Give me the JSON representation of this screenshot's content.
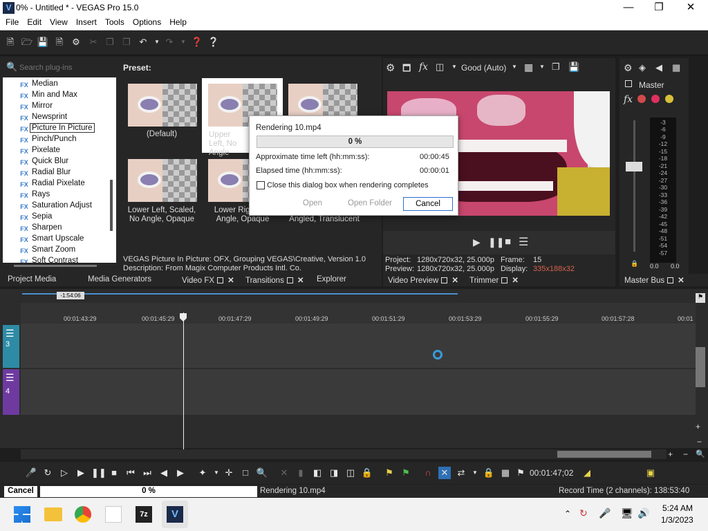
{
  "window": {
    "title": "0% - Untitled * - VEGAS Pro 15.0",
    "app_icon": "V"
  },
  "menu": [
    "File",
    "Edit",
    "View",
    "Insert",
    "Tools",
    "Options",
    "Help"
  ],
  "plugins": {
    "search_placeholder": "Search plug-ins",
    "items": [
      "Median",
      "Min and Max",
      "Mirror",
      "Newsprint",
      "Picture In Picture",
      "Pinch/Punch",
      "Pixelate",
      "Quick Blur",
      "Radial Blur",
      "Radial Pixelate",
      "Rays",
      "Saturation Adjust",
      "Sepia",
      "Sharpen",
      "Smart Upscale",
      "Smart Zoom",
      "Soft Contrast"
    ],
    "selected": "Picture In Picture",
    "fx_label": "FX"
  },
  "presets": {
    "label": "Preset:",
    "items": [
      "(Default)",
      "Upper Left, No Angle",
      "Lower Left, Scaled, No Angle, Opaque",
      "Lower Right, No Angle, Opaque",
      "Angled, Translucent"
    ]
  },
  "description": {
    "line1": "VEGAS Picture In Picture: OFX, Grouping VEGAS\\Creative, Version 1.0",
    "line2": "Description: From Magix Computer Products Intl. Co."
  },
  "left_tabs": {
    "project_media": "Project Media",
    "media_generators": "Media Generators",
    "video_fx": "Video FX",
    "transitions": "Transitions",
    "explorer": "Explorer"
  },
  "preview": {
    "quality": "Good (Auto)",
    "project_label": "Project:",
    "project_value": "1280x720x32, 25.000p",
    "preview_label": "Preview:",
    "preview_value": "1280x720x32, 25.000p",
    "frame_label": "Frame:",
    "frame_value": "15",
    "display_label": "Display:",
    "display_value": "335x188x32",
    "tab_video_preview": "Video Preview",
    "tab_trimmer": "Trimmer",
    "display_color": "#d8624e"
  },
  "mixer": {
    "master": "Master",
    "meter_labels": [
      "-3",
      "-6",
      "-9",
      "-12",
      "-15",
      "-18",
      "-21",
      "-24",
      "-27",
      "-30",
      "-33",
      "-36",
      "-39",
      "-42",
      "-45",
      "-48",
      "-51",
      "-54",
      "-57"
    ],
    "peak_left": "0.0",
    "peak_right": "0.0",
    "tab_master_bus": "Master Bus"
  },
  "dialog": {
    "title": "Rendering 10.mp4",
    "progress": "0 %",
    "time_left_label": "Approximate time left (hh:mm:ss):",
    "time_left_value": "00:00:45",
    "elapsed_label": "Elapsed time (hh:mm:ss):",
    "elapsed_value": "00:00:01",
    "close_checkbox": "Close this dialog box when rendering completes",
    "open": "Open",
    "open_folder": "Open Folder",
    "cancel": "Cancel"
  },
  "timeline": {
    "region_marker": "-1:54:06",
    "ticks": [
      "00:01:43:29",
      "00:01:45:29",
      "00:01:47:29",
      "00:01:49:29",
      "00:01:51:29",
      "00:01:53:29",
      "00:01:55:29",
      "00:01:57:28",
      "00:01"
    ],
    "track1_number": "3",
    "track2_number": "4"
  },
  "transport": {
    "time": "00:01:47;02"
  },
  "status": {
    "cancel": "Cancel",
    "progress": "0 %",
    "rendering": "Rendering 10.mp4",
    "record_time": "Record Time (2 channels): 138:53:40"
  },
  "taskbar": {
    "time": "5:24 AM",
    "date": "1/3/2023"
  }
}
